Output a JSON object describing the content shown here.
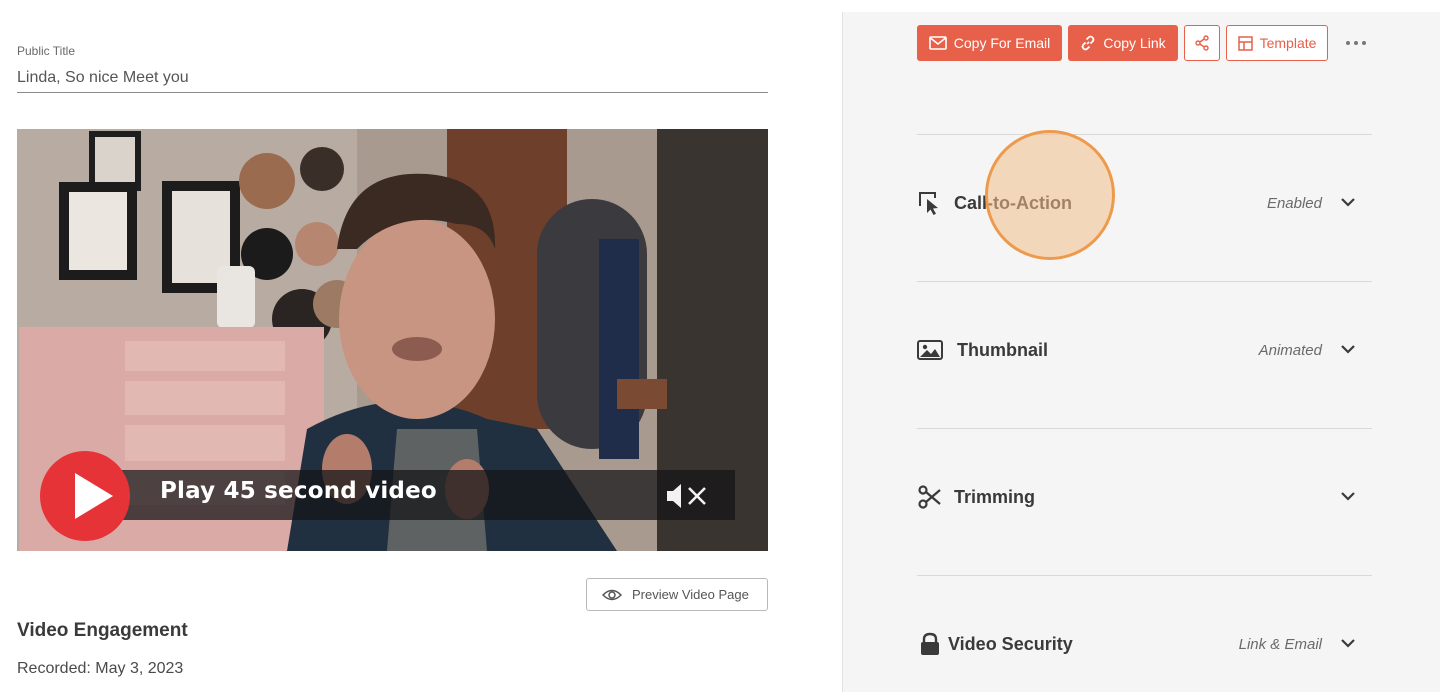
{
  "left": {
    "public_title_label": "Public Title",
    "public_title_value": "Linda, So nice Meet you",
    "video": {
      "play_text": "Play 45 second video"
    },
    "preview_button_label": "Preview Video Page",
    "engagement_heading": "Video Engagement",
    "recorded_text": "Recorded: May 3, 2023"
  },
  "toolbar": {
    "copy_email_label": "Copy For Email",
    "copy_link_label": "Copy Link",
    "template_label": "Template"
  },
  "settings": [
    {
      "label": "Call-to-Action",
      "status": "Enabled",
      "icon": "cursor-click-icon"
    },
    {
      "label": "Thumbnail",
      "status": "Animated",
      "icon": "image-icon"
    },
    {
      "label": "Trimming",
      "status": "",
      "icon": "scissors-icon"
    },
    {
      "label": "Video Security",
      "status": "Link & Email",
      "icon": "lock-icon"
    }
  ],
  "colors": {
    "accent": "#e6604a",
    "play_red": "#e63338",
    "panel_bg": "#f4f5f4"
  }
}
